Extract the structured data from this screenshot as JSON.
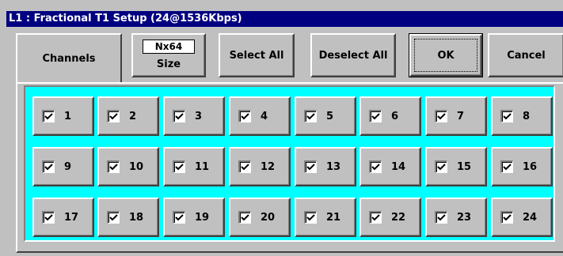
{
  "window": {
    "title": "L1 : Fractional T1 Setup (24@1536Kbps)"
  },
  "toolbar": {
    "channels_tab": "Channels",
    "size_value": "Nx64",
    "size_label": "Size",
    "select_all": "Select All",
    "deselect_all": "Deselect All",
    "ok": "OK",
    "cancel": "Cancel"
  },
  "channels": [
    {
      "label": "1",
      "checked": true
    },
    {
      "label": "2",
      "checked": true
    },
    {
      "label": "3",
      "checked": true
    },
    {
      "label": "4",
      "checked": true
    },
    {
      "label": "5",
      "checked": true
    },
    {
      "label": "6",
      "checked": true
    },
    {
      "label": "7",
      "checked": true
    },
    {
      "label": "8",
      "checked": true
    },
    {
      "label": "9",
      "checked": true
    },
    {
      "label": "10",
      "checked": true
    },
    {
      "label": "11",
      "checked": true
    },
    {
      "label": "12",
      "checked": true
    },
    {
      "label": "13",
      "checked": true
    },
    {
      "label": "14",
      "checked": true
    },
    {
      "label": "15",
      "checked": true
    },
    {
      "label": "16",
      "checked": true
    },
    {
      "label": "17",
      "checked": true
    },
    {
      "label": "18",
      "checked": true
    },
    {
      "label": "19",
      "checked": true
    },
    {
      "label": "20",
      "checked": true
    },
    {
      "label": "21",
      "checked": true
    },
    {
      "label": "22",
      "checked": true
    },
    {
      "label": "23",
      "checked": true
    },
    {
      "label": "24",
      "checked": true
    }
  ],
  "colors": {
    "titlebar": "#000080",
    "grid_background": "#00ffff",
    "face": "#c0c0c0"
  }
}
